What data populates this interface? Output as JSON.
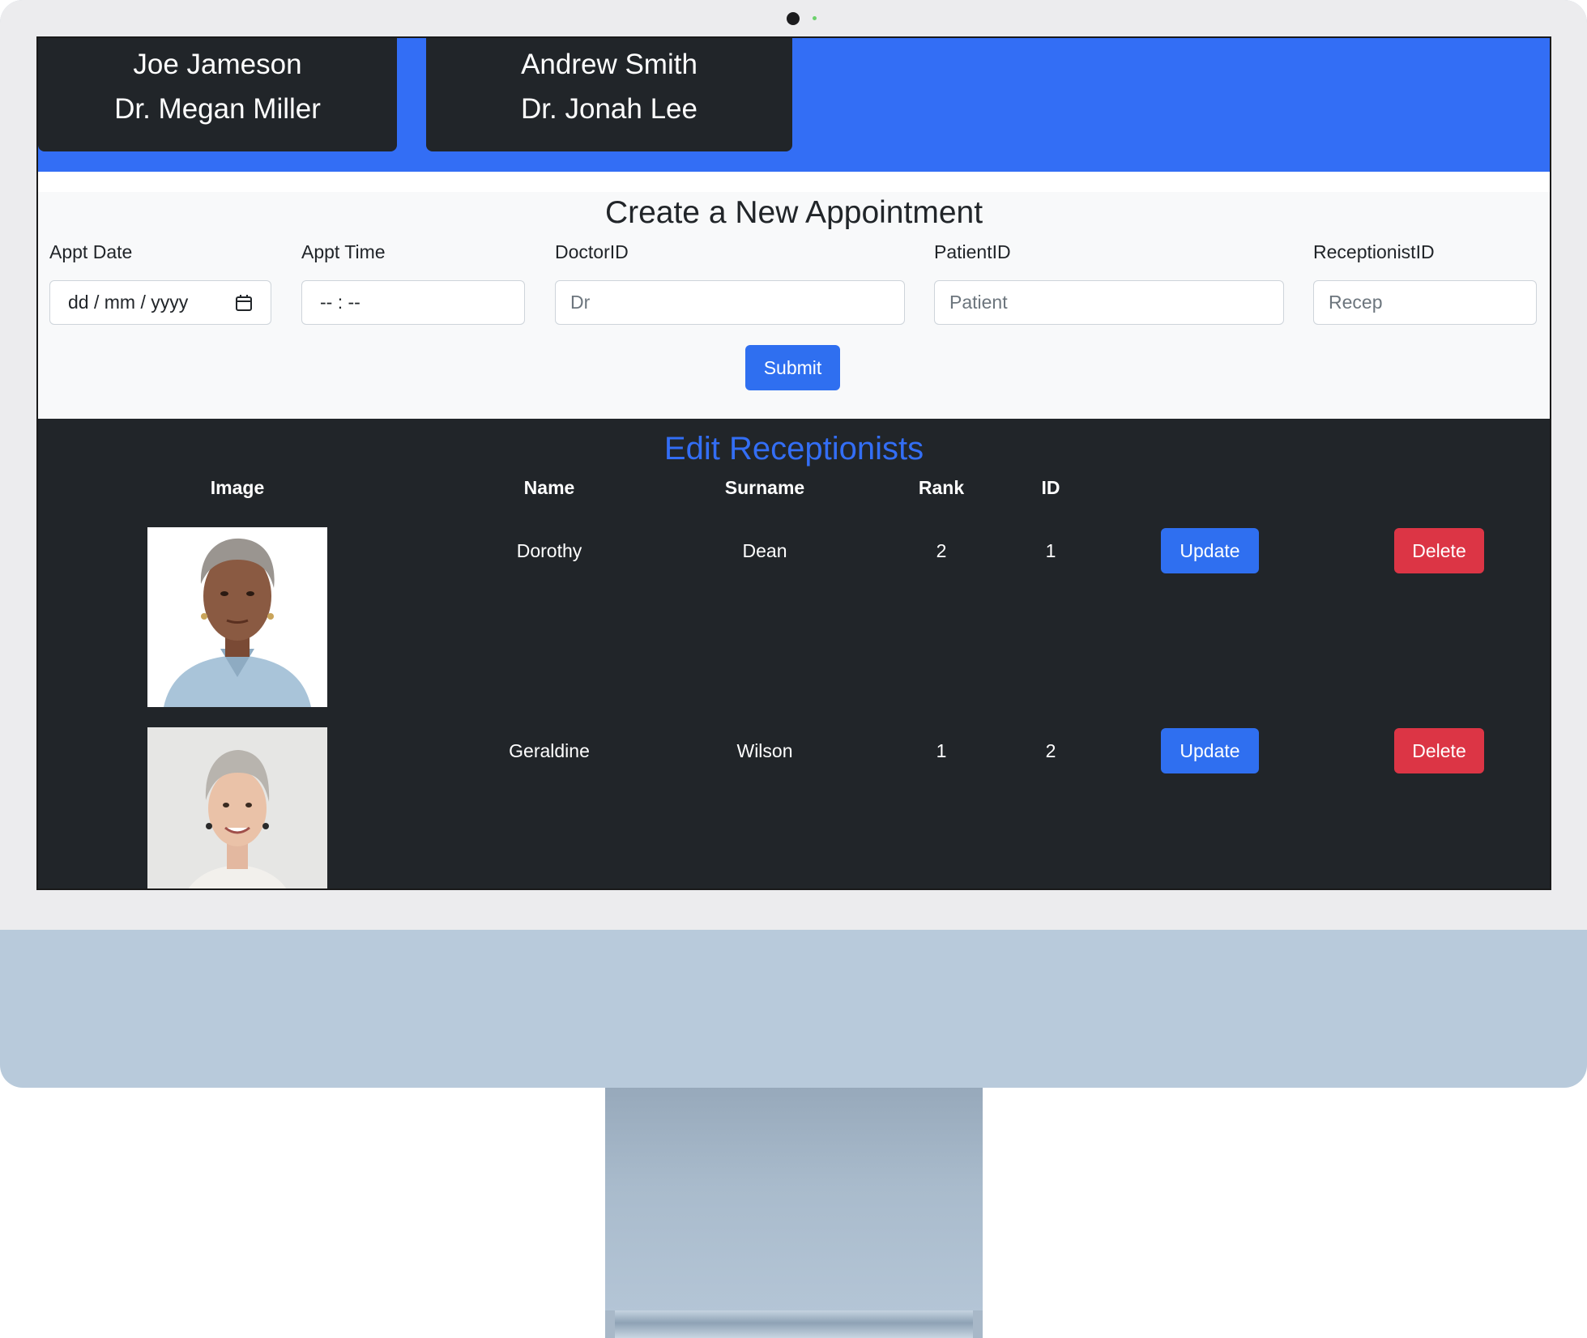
{
  "doctor_cards": [
    {
      "patient": "Joe Jameson",
      "doctor": "Dr. Megan Miller"
    },
    {
      "patient": "Andrew Smith",
      "doctor": "Dr. Jonah Lee"
    }
  ],
  "appointment_form": {
    "title": "Create a New Appointment",
    "fields": {
      "date": {
        "label": "Appt Date",
        "display": "dd / mm / yyyy"
      },
      "time": {
        "label": "Appt Time",
        "display": "-- : --"
      },
      "doctor": {
        "label": "DoctorID",
        "placeholder": "Dr"
      },
      "patient": {
        "label": "PatientID",
        "placeholder": "Patient"
      },
      "receptionist": {
        "label": "ReceptionistID",
        "placeholder": "Recep"
      }
    },
    "submit_label": "Submit"
  },
  "receptionists": {
    "title": "Edit Receptionists",
    "columns": [
      "Image",
      "Name",
      "Surname",
      "Rank",
      "ID"
    ],
    "rows": [
      {
        "name": "Dorothy",
        "surname": "Dean",
        "rank": "2",
        "id": "1",
        "update_label": "Update",
        "delete_label": "Delete"
      },
      {
        "name": "Geraldine",
        "surname": "Wilson",
        "rank": "1",
        "id": "2",
        "update_label": "Update",
        "delete_label": "Delete"
      }
    ]
  },
  "colors": {
    "banner": "#336ef5",
    "card": "#212529",
    "primary_button": "#2f6ff0",
    "danger_button": "#dc3545",
    "table_title": "#336ef5"
  },
  "icons": {
    "date_picker": "calendar-icon"
  }
}
